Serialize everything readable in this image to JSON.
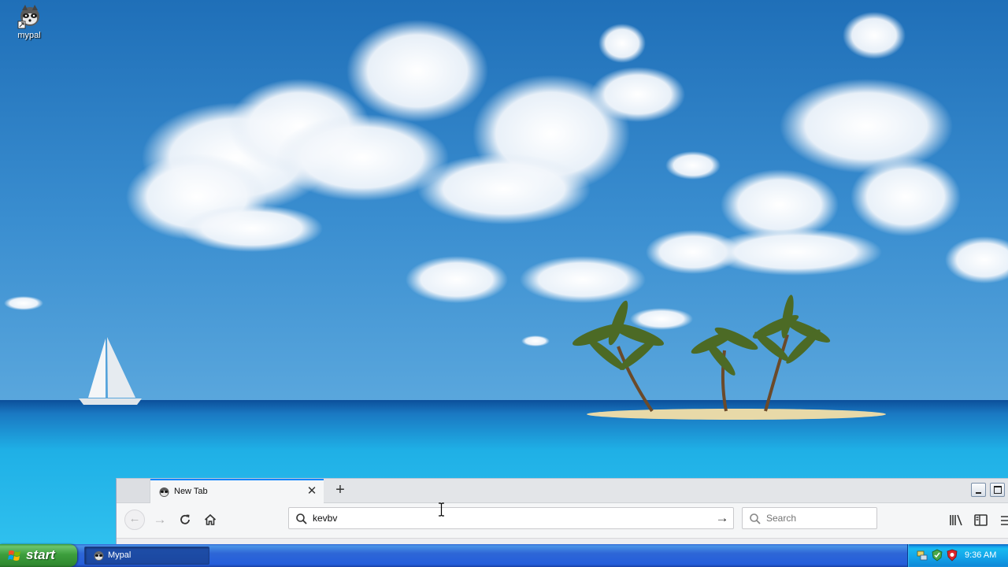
{
  "desktop": {
    "icons": [
      {
        "label": "mypal",
        "icon": "mypal-raccoon-icon"
      }
    ]
  },
  "browser": {
    "tabs": [
      {
        "title": "New Tab",
        "favicon": "mypal-favicon",
        "active": true
      }
    ],
    "urlbar": {
      "value": "kevbv",
      "placeholder": ""
    },
    "searchbar": {
      "placeholder": "Search",
      "value": ""
    },
    "accent_color": "#0a84ff"
  },
  "taskbar": {
    "start_label": "start",
    "tasks": [
      {
        "label": "Mypal",
        "icon": "mypal-favicon"
      }
    ],
    "tray_icons": [
      "network-icon",
      "security-icon",
      "antivirus-shield-icon"
    ],
    "clock": "9:36 AM"
  }
}
